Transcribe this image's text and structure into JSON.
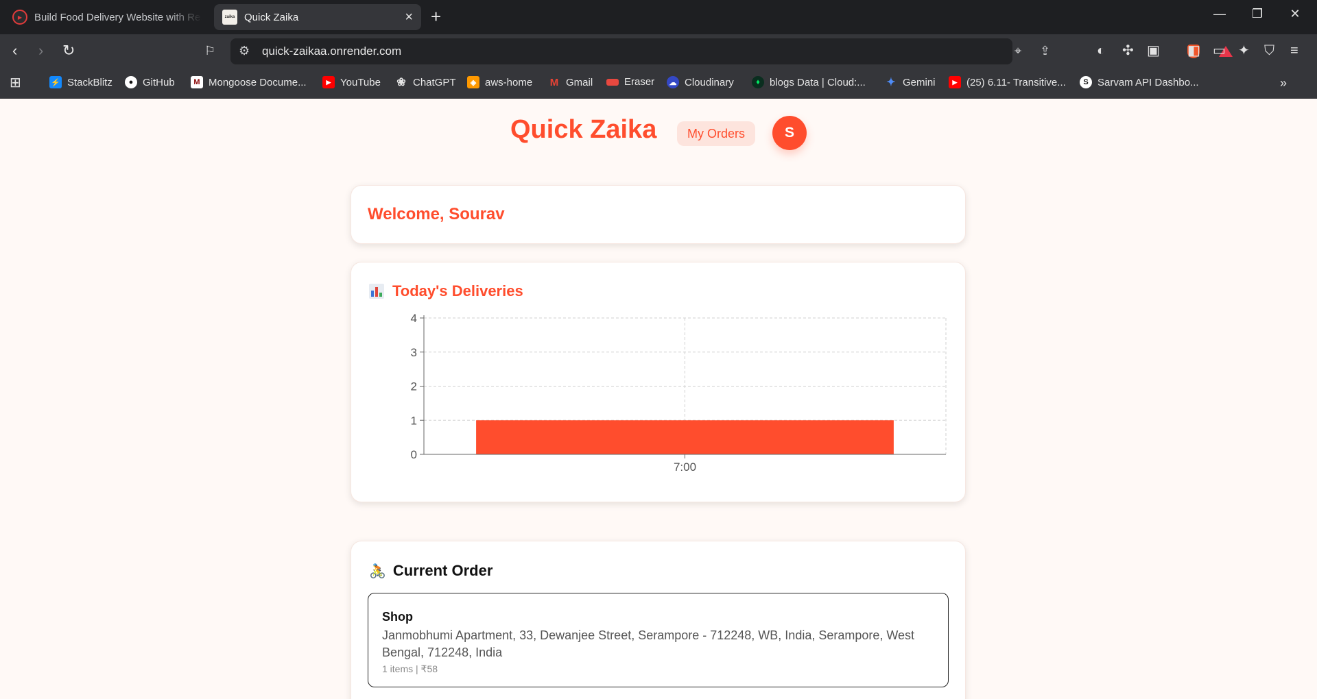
{
  "browser": {
    "tabs": [
      {
        "title": "Build Food Delivery Website with Rea",
        "active": false
      },
      {
        "title": "Quick Zaika",
        "active": true,
        "favicon_text": "zaika"
      }
    ],
    "url": "quick-zaikaa.onrender.com",
    "bookmarks": [
      {
        "label": "StackBlitz",
        "icon": "stackblitz-icon",
        "color": "#1389fd"
      },
      {
        "label": "GitHub",
        "icon": "github-icon",
        "color": "#ffffff"
      },
      {
        "label": "Mongoose Docume...",
        "icon": "mongoose-icon",
        "color": "#880000"
      },
      {
        "label": "YouTube",
        "icon": "youtube-icon",
        "color": "#ff0000"
      },
      {
        "label": "ChatGPT",
        "icon": "chatgpt-icon",
        "color": "#e6e6e6"
      },
      {
        "label": "aws-home",
        "icon": "aws-icon",
        "color": "#ff9900"
      },
      {
        "label": "Gmail",
        "icon": "gmail-icon",
        "color": "#ea4335"
      },
      {
        "label": "Eraser",
        "icon": "eraser-icon",
        "color": "#e8483f"
      },
      {
        "label": "Cloudinary",
        "icon": "cloudinary-icon",
        "color": "#3448c5"
      },
      {
        "label": "blogs Data | Cloud:...",
        "icon": "mongodb-icon",
        "color": "#00ed64"
      },
      {
        "label": "Gemini",
        "icon": "gemini-icon",
        "color": "#4f8cf7"
      },
      {
        "label": "(25) 6.11- Transitive...",
        "icon": "youtube-icon",
        "color": "#ff0000"
      },
      {
        "label": "Sarvam API Dashbo...",
        "icon": "sarvam-icon",
        "color": "#ffffff"
      }
    ]
  },
  "header": {
    "brand": "Quick Zaika",
    "my_orders": "My Orders",
    "avatar_initial": "S"
  },
  "welcome": {
    "text": "Welcome, Sourav"
  },
  "deliveries": {
    "title": "Today's Deliveries"
  },
  "chart_data": {
    "type": "bar",
    "categories": [
      "7:00"
    ],
    "values": [
      1
    ],
    "title": "",
    "xlabel": "",
    "ylabel": "",
    "ylim": [
      0,
      4
    ],
    "yticks": [
      0,
      1,
      2,
      3,
      4
    ],
    "grid": true,
    "bar_color": "#ff4d2d"
  },
  "current_order": {
    "title": "Current Order",
    "shop_label": "Shop",
    "address": "Janmobhumi Apartment, 33, Dewanjee Street, Serampore - 712248, WB, India, Serampore, West Bengal, 712248, India",
    "meta": "1 items | ₹58"
  },
  "colors": {
    "accent": "#ff4d2d",
    "accent_light": "#fde4dd",
    "page_bg": "#fff9f6"
  }
}
